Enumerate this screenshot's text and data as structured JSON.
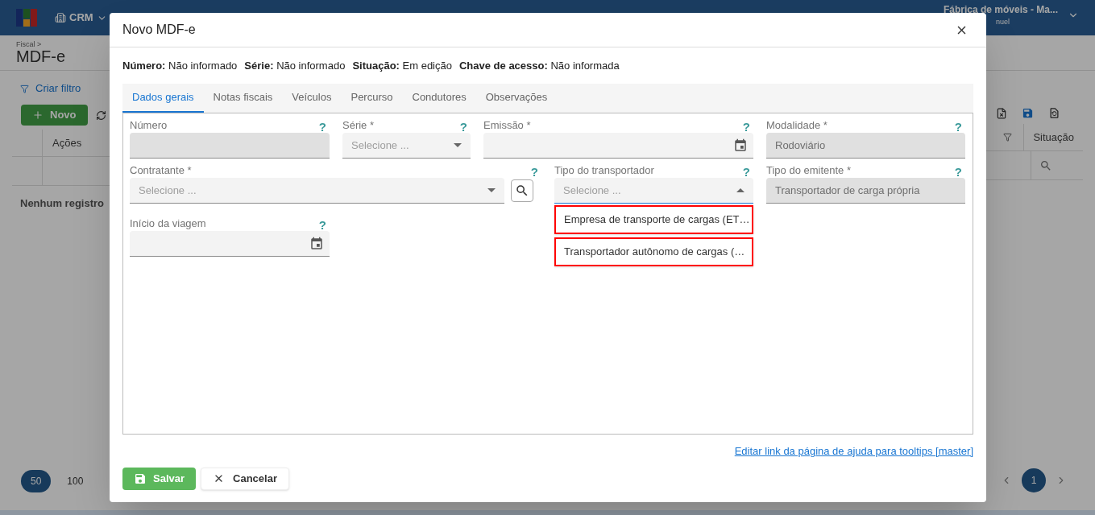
{
  "app_header": {
    "module": "CRM",
    "company": "Fábrica de móveis - Ma...",
    "user": "nuel"
  },
  "page": {
    "breadcrumb": "Fiscal >",
    "title": "MDF-e",
    "filter_link": "Criar filtro",
    "new_button": "Novo",
    "table": {
      "columns": [
        "Ações",
        "Situação"
      ],
      "empty_message": "Nenhum registro"
    },
    "page_sizes": [
      {
        "label": "50",
        "selected": true
      },
      {
        "label": "100",
        "selected": false
      }
    ],
    "pages": [
      {
        "label": "1",
        "selected": true
      }
    ]
  },
  "dialog": {
    "title": "Novo MDF-e",
    "summary": [
      {
        "label": "Número:",
        "value": "Não informado"
      },
      {
        "label": "Série:",
        "value": "Não informado"
      },
      {
        "label": "Situação:",
        "value": "Em edição"
      },
      {
        "label": "Chave de acesso:",
        "value": "Não informada"
      }
    ],
    "tabs": [
      {
        "label": "Dados gerais",
        "selected": true
      },
      {
        "label": "Notas fiscais",
        "selected": false
      },
      {
        "label": "Veículos",
        "selected": false
      },
      {
        "label": "Percurso",
        "selected": false
      },
      {
        "label": "Condutores",
        "selected": false
      },
      {
        "label": "Observações",
        "selected": false
      }
    ],
    "fields": [
      {
        "label": "Número",
        "kind": "text",
        "disabled": true,
        "help": "?"
      },
      {
        "label": "Série *",
        "kind": "select",
        "disabled": false,
        "placeholder": "Selecione ...",
        "help": "?"
      },
      {
        "label": "Emissão *",
        "kind": "date",
        "disabled": false,
        "help": "?"
      },
      {
        "label": "Modalidade *",
        "kind": "text",
        "disabled": true,
        "value": "Rodoviário",
        "help": "?"
      },
      {
        "label": "Contratante *",
        "kind": "lookup",
        "disabled": false,
        "placeholder": "Selecione ...",
        "help": "?"
      },
      {
        "label": "Tipo do transportador",
        "kind": "select",
        "disabled": false,
        "open": true,
        "placeholder": "Selecione ...",
        "help": "?",
        "options": [
          {
            "label": "Empresa de transporte de cargas (ET…",
            "highlighted": true
          },
          {
            "label": "Transportador autônomo de cargas (…",
            "highlighted": true
          }
        ]
      },
      {
        "label": "Tipo do emitente *",
        "kind": "text",
        "disabled": true,
        "value": "Transportador de carga própria",
        "help": "?"
      },
      {
        "label": "Início da viagem",
        "kind": "date",
        "disabled": false,
        "help": "?"
      }
    ],
    "help_link": "Editar link da página de ajuda para tooltips [master]",
    "buttons": [
      {
        "label": "Salvar",
        "kind": "primary"
      },
      {
        "label": "Cancelar",
        "kind": "secondary"
      }
    ]
  }
}
